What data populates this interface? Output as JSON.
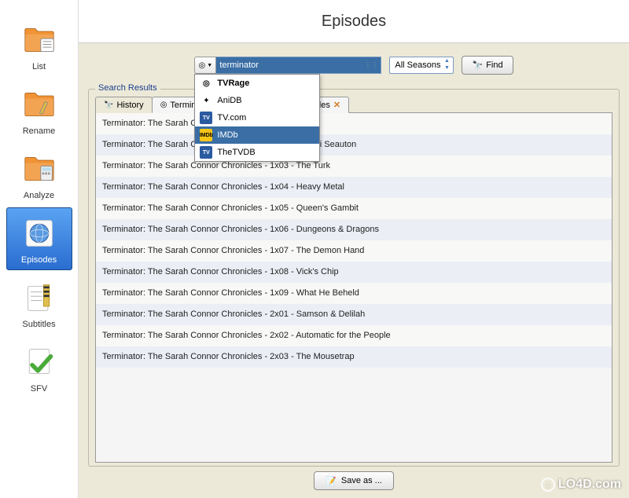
{
  "title": "Episodes",
  "sidebar": {
    "items": [
      {
        "label": "List",
        "iconColor": "#f19436",
        "type": "folder-lines"
      },
      {
        "label": "Rename",
        "iconColor": "#f19436",
        "type": "folder-pencil"
      },
      {
        "label": "Analyze",
        "iconColor": "#f19436",
        "type": "folder-calc"
      },
      {
        "label": "Episodes",
        "iconColor": "#3a7ad0",
        "type": "globe"
      },
      {
        "label": "Subtitles",
        "iconColor": "#e0d070",
        "type": "subtitles"
      },
      {
        "label": "SFV",
        "iconColor": "#4aaa3a",
        "type": "check"
      }
    ],
    "selected": 3
  },
  "search": {
    "value": "terminator",
    "season_label": "All Seasons",
    "find_label": "Find"
  },
  "dropdown": {
    "items": [
      {
        "label": "TVRage",
        "bold": true,
        "icon": "◎"
      },
      {
        "label": "AniDB",
        "bold": false,
        "icon": "✦"
      },
      {
        "label": "TV.com",
        "bold": false,
        "icon": "TV"
      },
      {
        "label": "IMDb",
        "bold": false,
        "icon": "IMDb",
        "hovered": true
      },
      {
        "label": "TheTVDB",
        "bold": false,
        "icon": "TV"
      }
    ]
  },
  "fieldset_label": "Search Results",
  "tabs": [
    {
      "label": "History",
      "closable": false,
      "icon": "🔍",
      "active": false
    },
    {
      "label": "Terminator: The Sarah Connor Chronicles",
      "closable": true,
      "icon": "◎",
      "active": true,
      "truncated": "Te"
    }
  ],
  "results": [
    "Terminator: The Sarah Connor Chronicles - 1x01 - Pilot",
    "Terminator: The Sarah Connor Chronicles - 1x02 - Gnothi Seauton",
    "Terminator: The Sarah Connor Chronicles - 1x03 - The Turk",
    "Terminator: The Sarah Connor Chronicles - 1x04 - Heavy Metal",
    "Terminator: The Sarah Connor Chronicles - 1x05 - Queen's Gambit",
    "Terminator: The Sarah Connor Chronicles - 1x06 - Dungeons & Dragons",
    "Terminator: The Sarah Connor Chronicles - 1x07 - The Demon Hand",
    "Terminator: The Sarah Connor Chronicles - 1x08 - Vick's Chip",
    "Terminator: The Sarah Connor Chronicles - 1x09 - What He Beheld",
    "Terminator: The Sarah Connor Chronicles - 2x01 - Samson & Delilah",
    "Terminator: The Sarah Connor Chronicles - 2x02 - Automatic for the People",
    "Terminator: The Sarah Connor Chronicles - 2x03 - The Mousetrap"
  ],
  "save_label": "Save as ...",
  "watermark": "LO4D.com"
}
